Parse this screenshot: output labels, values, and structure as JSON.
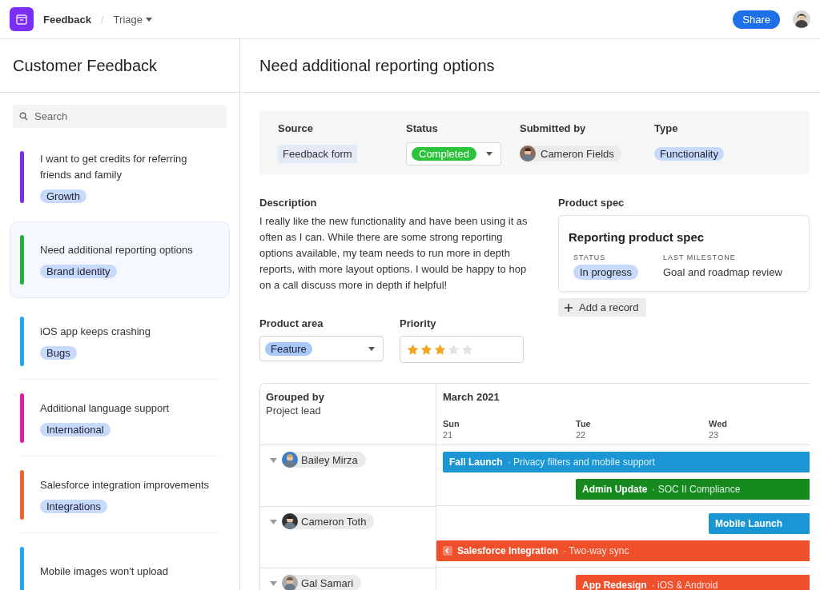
{
  "topbar": {
    "breadcrumb": [
      "Feedback",
      "Triage"
    ],
    "separator": "/",
    "share": "Share"
  },
  "sidebar": {
    "title": "Customer Feedback",
    "search": {
      "placeholder": "Search"
    },
    "items": [
      {
        "title": "I want to get credits for referring friends and family",
        "tag": "Growth",
        "color": "#7c2df0",
        "selected": false
      },
      {
        "title": "Need additional reporting options",
        "tag": "Brand identity",
        "color": "#22b33a",
        "selected": true
      },
      {
        "title": "iOS app keeps crashing",
        "tag": "Bugs",
        "color": "#1ea7f0",
        "selected": false
      },
      {
        "title": "Additional language support",
        "tag": "International",
        "color": "#e81aa8",
        "selected": false
      },
      {
        "title": "Salesforce integration improvements",
        "tag": "Integrations",
        "color": "#f0622b",
        "selected": false
      },
      {
        "title": "Mobile images won't upload",
        "color": "#1ea7f0",
        "selected": false
      }
    ]
  },
  "detail": {
    "title": "Need additional reporting options",
    "fields": [
      {
        "label": "Source",
        "kind": "tag",
        "value": "Feedback form"
      },
      {
        "label": "Status",
        "kind": "select",
        "value": "Completed"
      },
      {
        "label": "Submitted by",
        "kind": "person",
        "value": "Cameron Fields"
      },
      {
        "label": "Type",
        "kind": "pill",
        "value": "Functionality"
      }
    ],
    "description": {
      "label": "Description",
      "text": "I really like the new functionality and have been using it as often as I can. While there are some strong reporting options available, my team needs to run more in depth reports, with more layout options. I would be happy to hop on a call discuss more in depth if helpful!"
    },
    "product_spec": {
      "label": "Product spec",
      "title": "Reporting product spec",
      "status_label": "STATUS",
      "status": "In progress",
      "milestone_label": "LAST MILESTONE",
      "milestone": "Goal and roadmap review",
      "add": "Add a record"
    },
    "product_area": {
      "label": "Product area",
      "value": "Feature"
    },
    "priority": {
      "label": "Priority",
      "stars": 3
    },
    "timeline": {
      "grouped_label": "Grouped by",
      "grouped_value": "Project lead",
      "month": "March 2021",
      "days": [
        {
          "name": "Sun",
          "date": "21"
        },
        {
          "name": "Tue",
          "date": "22"
        },
        {
          "name": "Wed",
          "date": "23"
        }
      ],
      "rows": [
        {
          "lead": "Bailey Mirza",
          "lanes": [
            {
              "kind": "sun",
              "title": "Fall Launch",
              "subtitle": "· Privacy filters and mobile support",
              "color": "#1a96d4"
            },
            {
              "kind": "tue",
              "title": "Admin Update",
              "subtitle": "· SOC II Compliance",
              "color": "#178a1f"
            }
          ]
        },
        {
          "lead": "Cameron Toth",
          "lanes": [
            {
              "kind": "wed",
              "title": "Mobile Launch",
              "color": "#1a96d4"
            },
            {
              "kind": "earlier",
              "title": "Salesforce Integration",
              "subtitle": "· Two-way sync",
              "color": "#f04f2c"
            }
          ]
        },
        {
          "lead": "Gal Samari",
          "lanes": [
            {
              "kind": "tue",
              "title": "App Redesign",
              "subtitle": "· iOS & Android",
              "color": "#f04f2c"
            }
          ]
        }
      ]
    }
  }
}
